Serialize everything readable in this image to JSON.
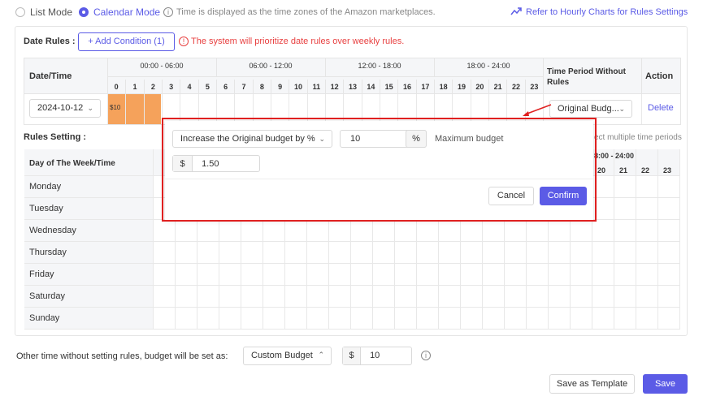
{
  "top": {
    "list_mode": "List Mode",
    "calendar_mode": "Calendar Mode",
    "timezone_note": "Time is displayed as the time zones of the Amazon marketplaces.",
    "hourly_link": "Refer to Hourly Charts for Rules Settings"
  },
  "date_rules": {
    "label": "Date Rules :",
    "add_condition": "+ Add Condition (1)",
    "warning": "The system will prioritize date rules over weekly rules.",
    "col_date": "Date/Time",
    "groups": [
      "00:00 - 06:00",
      "06:00 - 12:00",
      "12:00 - 18:00",
      "18:00 - 24:00"
    ],
    "hours": [
      "0",
      "1",
      "2",
      "3",
      "4",
      "5",
      "6",
      "7",
      "8",
      "9",
      "10",
      "11",
      "12",
      "13",
      "14",
      "15",
      "16",
      "17",
      "18",
      "19",
      "20",
      "21",
      "22",
      "23"
    ],
    "col_period": "Time Period Without Rules",
    "col_action": "Action",
    "row_date": "2024-10-12",
    "cell_value": "$10",
    "period_value": "Original Budg...",
    "delete": "Delete"
  },
  "rules_setting": {
    "label": "Rules Setting :",
    "hint": "ect multiple time periods",
    "col_day": "Day of The Week/Time",
    "group_partial": "8:00 - 24:00",
    "hours_partial": [
      "20",
      "21",
      "22",
      "23"
    ],
    "days": [
      "Monday",
      "Tuesday",
      "Wednesday",
      "Thursday",
      "Friday",
      "Saturday",
      "Sunday"
    ]
  },
  "modal": {
    "rule_type": "Increase the Original budget by %",
    "percent_value": "10",
    "percent_unit": "%",
    "max_label": "Maximum budget",
    "currency": "$",
    "max_value": "1.50",
    "cancel": "Cancel",
    "confirm": "Confirm"
  },
  "footer": {
    "other_time_label": "Other time without setting rules, budget will be set as:",
    "budget_type": "Custom Budget",
    "currency": "$",
    "budget_value": "10",
    "save_template": "Save as Template",
    "save": "Save"
  },
  "colors": {
    "accent": "#5b5be6",
    "highlight": "#f5a25b",
    "warning": "#e84040",
    "annotation": "#e02020"
  }
}
